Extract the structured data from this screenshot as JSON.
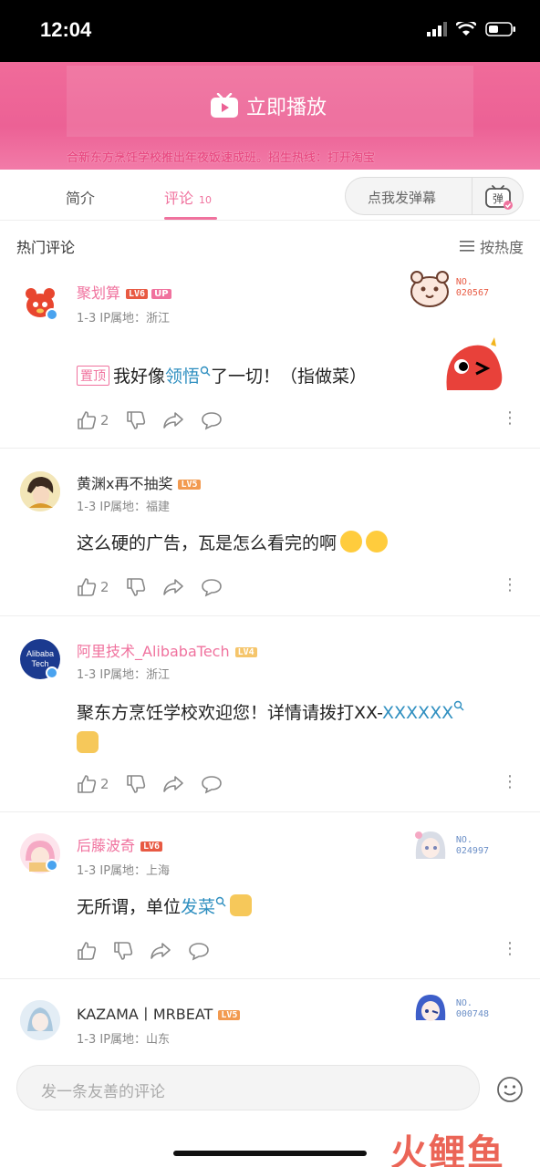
{
  "status": {
    "time": "12:04"
  },
  "player": {
    "play_label": "立即播放",
    "marquee": "合新东方烹饪学校推出年夜饭速成班。招生热线：打开淘宝"
  },
  "tabs": [
    {
      "label": "简介"
    },
    {
      "label": "评论",
      "count": "10"
    }
  ],
  "danmaku": {
    "placeholder": "点我发弹幕",
    "icon_label": "弹"
  },
  "section": {
    "title": "热门评论",
    "sort_label": "按热度"
  },
  "comments": [
    {
      "user": "聚划算",
      "level": "LV6",
      "up_tag": "UP",
      "meta": "1-3  IP属地：浙江",
      "pinned": "置顶",
      "text_before": "我好像",
      "link": "领悟",
      "text_after": "了一切！（指做菜）",
      "likes": "2",
      "badge_no": "NO.\n020567"
    },
    {
      "user": "黄渊x再不抽奖",
      "level": "LV5",
      "meta": "1-3  IP属地：福建",
      "text": "这么硬的广告，瓦是怎么看完的啊",
      "likes": "2"
    },
    {
      "user": "阿里技术_AlibabaTech",
      "level": "LV4",
      "meta": "1-3  IP属地：浙江",
      "text_before": "聚东方烹饪学校欢迎您！详情请拨打XX-",
      "link": "XXXXXX",
      "likes": "2",
      "avatar_text": "Alibaba Tech"
    },
    {
      "user": "后藤波奇",
      "level": "LV6",
      "meta": "1-3  IP属地：上海",
      "text_before": "无所谓，单位",
      "link": "发菜",
      "badge_no": "NO.\n024997"
    },
    {
      "user": "KAZAMA丨MRBEAT",
      "level": "LV5",
      "meta": "1-3  IP属地：山东",
      "badge_no": "NO.\n000748"
    }
  ],
  "input": {
    "placeholder": "发一条友善的评论"
  },
  "watermark": {
    "text": "火鲤鱼"
  },
  "colors": {
    "accent": "#f0729e",
    "link": "#2f8fc0"
  }
}
